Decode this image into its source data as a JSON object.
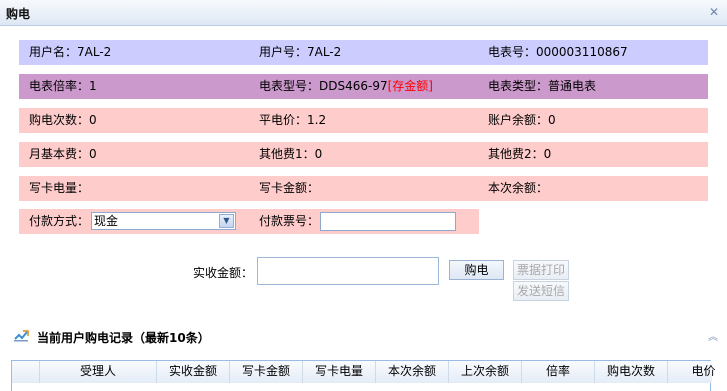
{
  "window": {
    "title": "购电",
    "close_icon": "close-icon"
  },
  "info": {
    "user_name": "用户名：7AL-2",
    "user_no": "用户号：7AL-2",
    "meter_no": "电表号：000003110867",
    "rate": "电表倍率：1",
    "model_prefix": "电表型号：DDS466-97",
    "model_tag": "[存金额]",
    "meter_type": "电表类型：普通电表",
    "buy_count": "购电次数：0",
    "flat_price": "平电价：1.2",
    "balance": "账户余额：0",
    "monthly_fee": "月基本费：0",
    "other_fee1": "其他费1：0",
    "other_fee2": "其他费2：0",
    "card_energy": "写卡电量：",
    "card_amount": "写卡金额：",
    "this_balance": "本次余额：",
    "pay_method_label": "付款方式：",
    "pay_method_value": "现金",
    "ticket_label": "付款票号："
  },
  "payment": {
    "paid_label": "实收金额：",
    "buy_button": "购电",
    "print_button": "票据打印",
    "sms_button": "发送短信"
  },
  "records": {
    "title": "当前用户购电记录（最新10条）",
    "columns": [
      "受理人",
      "实收金额",
      "写卡金额",
      "写卡电量",
      "本次余额",
      "上次余额",
      "倍率",
      "购电次数",
      "电价"
    ]
  },
  "colors": {
    "row_blue": "#ccccff",
    "row_purple": "#cc99cc",
    "row_pink": "#ffcccc",
    "tag_red": "#ff0000"
  }
}
